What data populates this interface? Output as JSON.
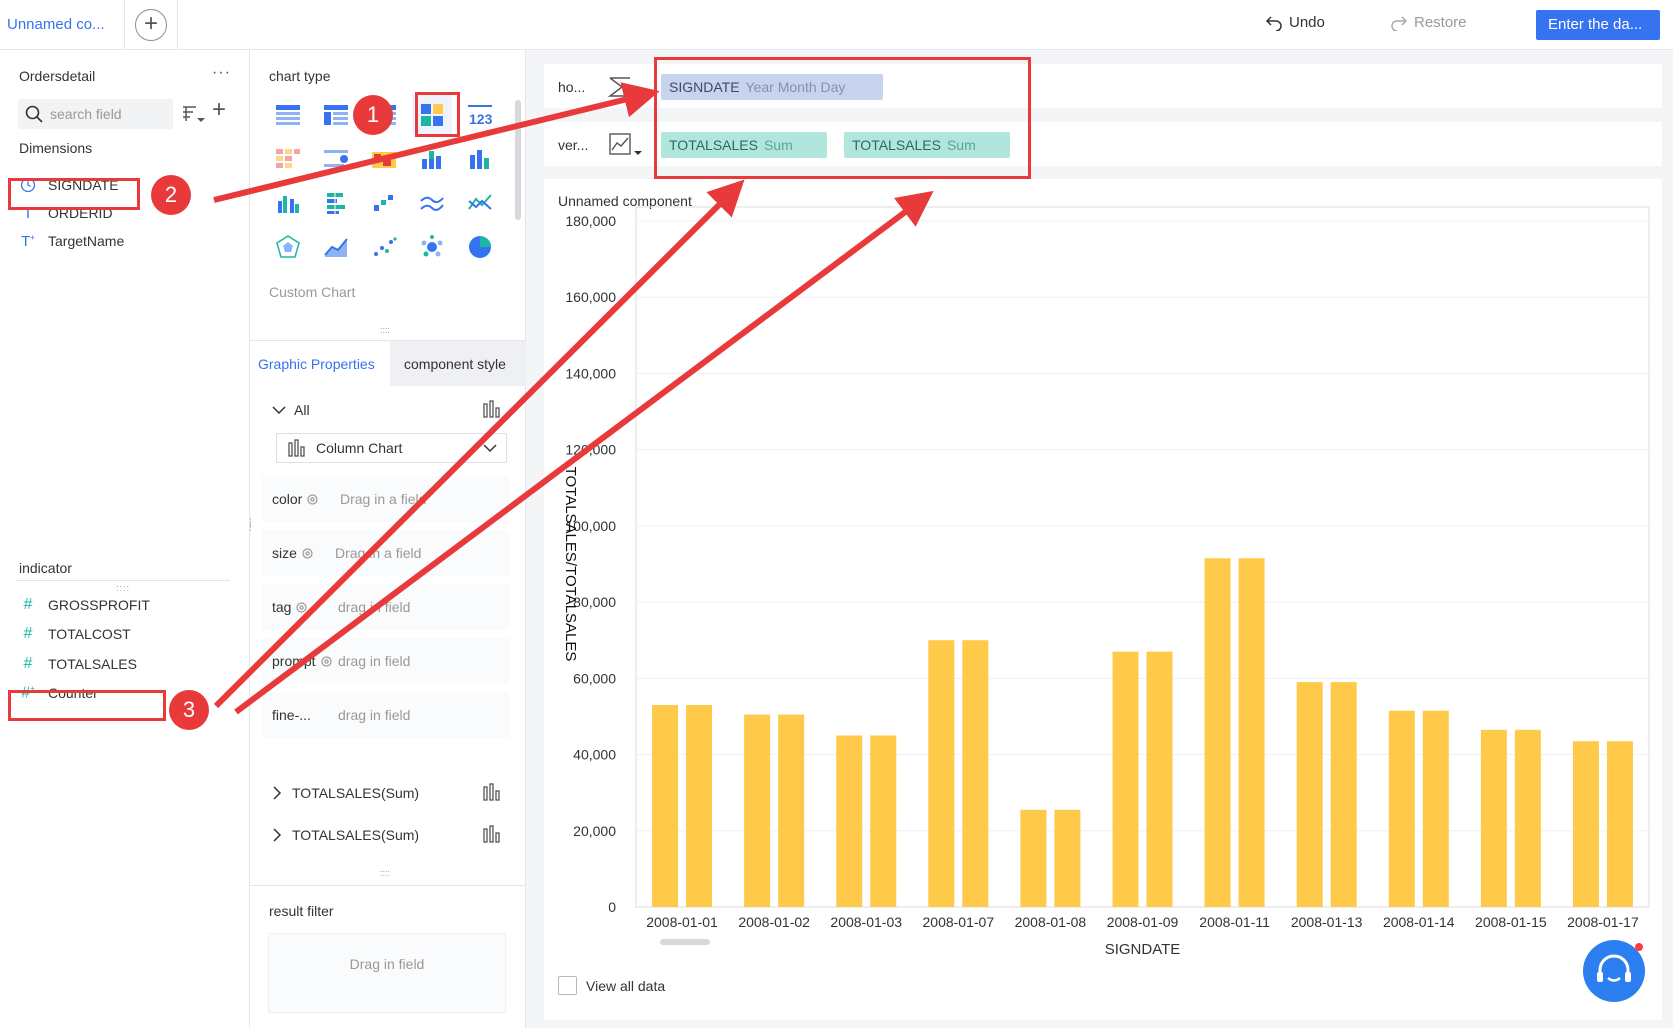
{
  "topbar": {
    "active_tab": "Unnamed co...",
    "add_tab": "+",
    "undo": "Undo",
    "restore": "Restore",
    "enter_data": "Enter the da..."
  },
  "fields": {
    "dataset_name": "Ordersdetail",
    "more": "···",
    "search_placeholder": "search field",
    "dimensions_label": "Dimensions",
    "dimensions": [
      {
        "name": "SIGNDATE",
        "icon": "clock-icon"
      },
      {
        "name": "ORDERID",
        "icon": "text-icon"
      },
      {
        "name": "TargetName",
        "icon": "text-icon"
      }
    ],
    "indicator_label": "indicator",
    "indicators": [
      {
        "name": "GROSSPROFIT",
        "icon": "hash-icon"
      },
      {
        "name": "TOTALCOST",
        "icon": "hash-icon"
      },
      {
        "name": "TOTALSALES",
        "icon": "hash-icon"
      },
      {
        "name": "Counter",
        "icon": "hash-icon"
      }
    ]
  },
  "config": {
    "chart_type_label": "chart type",
    "custom_chart": "Custom Chart",
    "tab_graphic": "Graphic Properties",
    "tab_style": "component style",
    "all_label": "All",
    "chart_select": "Column Chart",
    "props": [
      {
        "label": "color",
        "drop": "Drag in a field"
      },
      {
        "label": "size",
        "drop": "Drag in a field"
      },
      {
        "label": "tag",
        "drop": "drag in field"
      },
      {
        "label": "prompt",
        "drop": "drag in field"
      },
      {
        "label": "fine-...",
        "drop": "drag in field"
      }
    ],
    "measures": [
      "TOTALSALES(Sum)",
      "TOTALSALES(Sum)"
    ],
    "result_filter": "result filter",
    "result_drop": "Drag in field"
  },
  "axes": {
    "horizontal_label": "ho...",
    "vertical_label": "ver...",
    "horizontal_pills": [
      {
        "name": "SIGNDATE",
        "sub": "Year Month Day"
      }
    ],
    "vertical_pills": [
      {
        "name": "TOTALSALES",
        "sub": "Sum"
      },
      {
        "name": "TOTALSALES",
        "sub": "Sum"
      }
    ]
  },
  "chart": {
    "component_title": "Unnamed component",
    "view_all": "View all data"
  },
  "chart_data": {
    "type": "bar",
    "title": "Unnamed component",
    "xlabel": "SIGNDATE",
    "ylabel": "TOTALSALES/TOTALSALES",
    "ylim": [
      0,
      180000
    ],
    "yticks": [
      0,
      20000,
      40000,
      60000,
      80000,
      100000,
      120000,
      140000,
      160000,
      180000
    ],
    "ytick_labels": [
      "0",
      "20,000",
      "40,000",
      "60,000",
      "80,000",
      "100,000",
      "120,000",
      "140,000",
      "160,000",
      "180,000"
    ],
    "categories": [
      "2008-01-01",
      "2008-01-02",
      "2008-01-03",
      "2008-01-07",
      "2008-01-08",
      "2008-01-09",
      "2008-01-11",
      "2008-01-13",
      "2008-01-14",
      "2008-01-15",
      "2008-01-17"
    ],
    "series": [
      {
        "values": [
          53000,
          50500,
          45000,
          70000,
          25500,
          67000,
          91500,
          59000,
          51500,
          46500,
          43500
        ]
      },
      {
        "values": [
          53000,
          50500,
          45000,
          70000,
          25500,
          67000,
          91500,
          59000,
          51500,
          46500,
          43500
        ]
      }
    ],
    "colors": [
      "#ffc94a",
      "#ffc94a"
    ],
    "grid": true
  },
  "annotations": {
    "badges": [
      "1",
      "2",
      "3"
    ],
    "color": "#e83a3a"
  }
}
